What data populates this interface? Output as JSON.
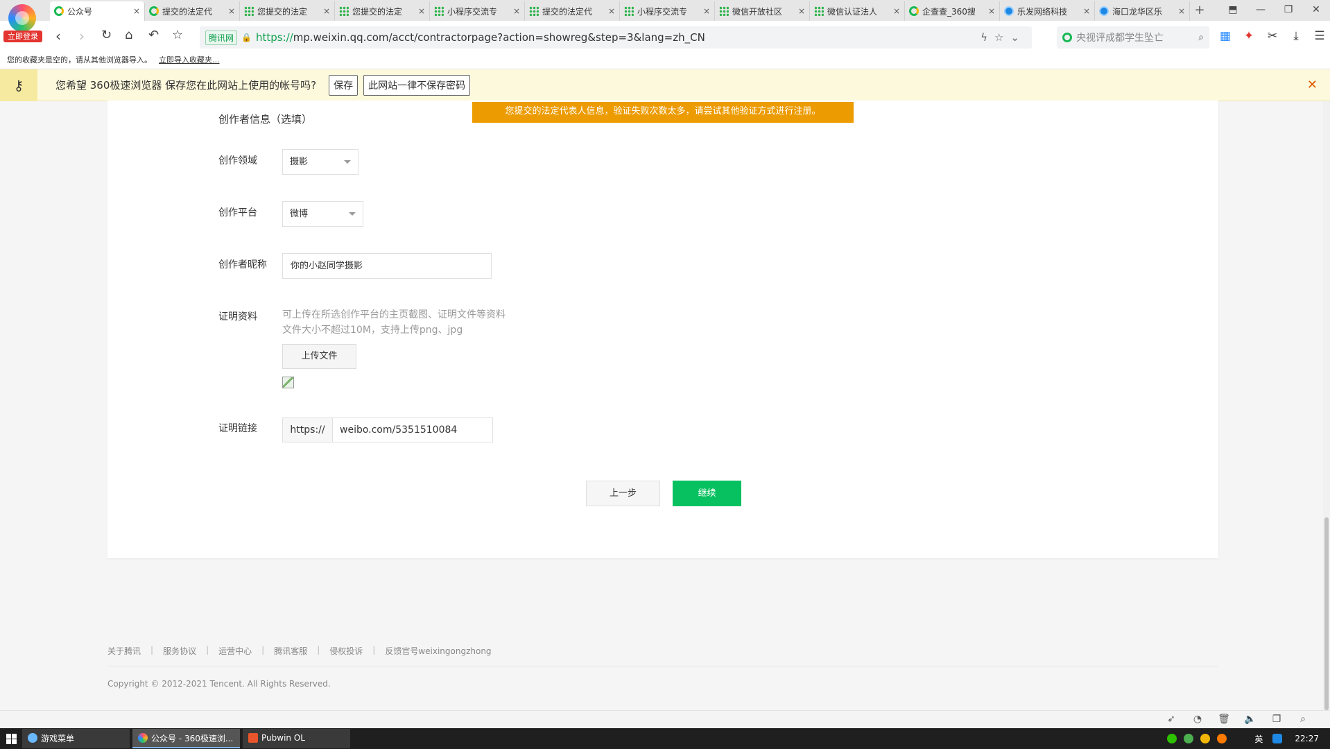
{
  "browser": {
    "login_badge": "立即登录",
    "tabs": [
      {
        "label": "公众号",
        "icon": "c360",
        "active": true
      },
      {
        "label": "提交的法定代",
        "icon": "c360"
      },
      {
        "label": "您提交的法定",
        "icon": "grid"
      },
      {
        "label": "您提交的法定",
        "icon": "grid"
      },
      {
        "label": "小程序交流专",
        "icon": "grid"
      },
      {
        "label": "提交的法定代",
        "icon": "grid"
      },
      {
        "label": "小程序交流专",
        "icon": "grid"
      },
      {
        "label": "微信开放社区",
        "icon": "grid"
      },
      {
        "label": "微信认证法人",
        "icon": "grid"
      },
      {
        "label": "企查查_360搜",
        "icon": "c360"
      },
      {
        "label": "乐发网络科技",
        "icon": "blue"
      },
      {
        "label": "海口龙华区乐",
        "icon": "blue"
      }
    ],
    "address": {
      "security_label": "腾讯网",
      "url_scheme": "https://",
      "url_rest": "mp.weixin.qq.com/acct/contractorpage?action=showreg&step=3&lang=zh_CN"
    },
    "search_placeholder": "央视评成都学生坠亡",
    "bookmarks": {
      "text": "您的收藏夹是空的，请从其他浏览器导入。",
      "import_link": "立即导入收藏夹..."
    },
    "password_bar": {
      "message": "您希望 360极速浏览器 保存您在此网站上使用的帐号吗?",
      "save": "保存",
      "never": "此网站一律不保存密码"
    }
  },
  "page": {
    "error_message": "您提交的法定代表人信息，验证失败次数太多，请尝试其他验证方式进行注册。",
    "section_title": "创作者信息（选填）",
    "fields": {
      "domain_label": "创作领域",
      "domain_value": "摄影",
      "platform_label": "创作平台",
      "platform_value": "微博",
      "nickname_label": "创作者昵称",
      "nickname_value": "你的小赵同学摄影",
      "proof_label": "证明资料",
      "proof_hint_1": "可上传在所选创作平台的主页截图、证明文件等资料",
      "proof_hint_2": "文件大小不超过10M，支持上传png、jpg",
      "upload_button": "上传文件",
      "link_label": "证明链接",
      "link_prefix": "https://",
      "link_value": "weibo.com/5351510084"
    },
    "buttons": {
      "prev": "上一步",
      "next": "继续"
    }
  },
  "footer": {
    "links": [
      "关于腾讯",
      "服务协议",
      "运营中心",
      "腾讯客服",
      "侵权投诉",
      "反馈官号weixingongzhong"
    ],
    "copyright": "Copyright © 2012-2021 Tencent. All Rights Reserved."
  },
  "taskbar": {
    "items": [
      {
        "label": "游戏菜单"
      },
      {
        "label": "公众号 - 360极速浏..."
      },
      {
        "label": "Pubwin OL"
      }
    ],
    "ime": "英",
    "time": "22:27"
  },
  "colors": {
    "accent_green": "#07c160",
    "error_orange": "#ec9b00"
  }
}
